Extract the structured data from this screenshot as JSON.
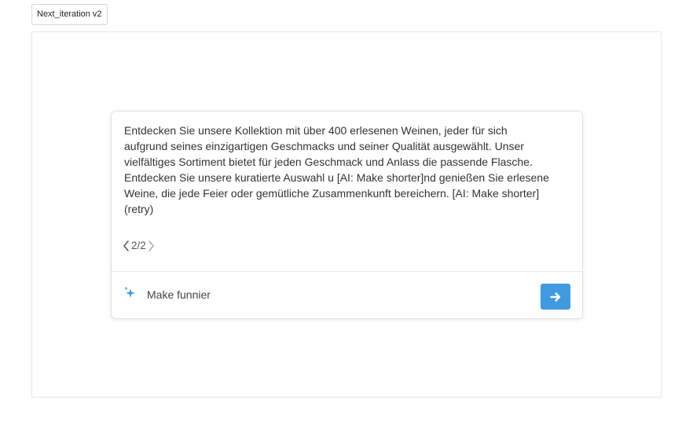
{
  "version_tag": {
    "label": "Next_iteration v2"
  },
  "ai_card": {
    "text": "Entdecken Sie unsere Kollektion mit über 400 erlesenen Weinen, jeder für sich\naufgrund seines einzigartigen Geschmacks und seiner Qualität ausgewählt. Unser\nvielfältiges Sortiment bietet für jeden Geschmack und Anlass die passende Flasche.\nEntdecken Sie unsere kuratierte Auswahl u [AI: Make shorter]nd genießen Sie erlesene\nWeine, die jede Feier oder gemütliche Zusammenkunft bereichern. [AI: Make shorter]\n(retry)",
    "pager": {
      "current_of_total": "2/2",
      "prev_icon": "chevron-left-icon",
      "next_icon": "chevron-right-icon"
    },
    "prompt": {
      "value": "Make funnier",
      "icon": "sparkle-icon"
    },
    "send": {
      "icon": "arrow-right-icon",
      "color": "#3f9ae0"
    }
  }
}
